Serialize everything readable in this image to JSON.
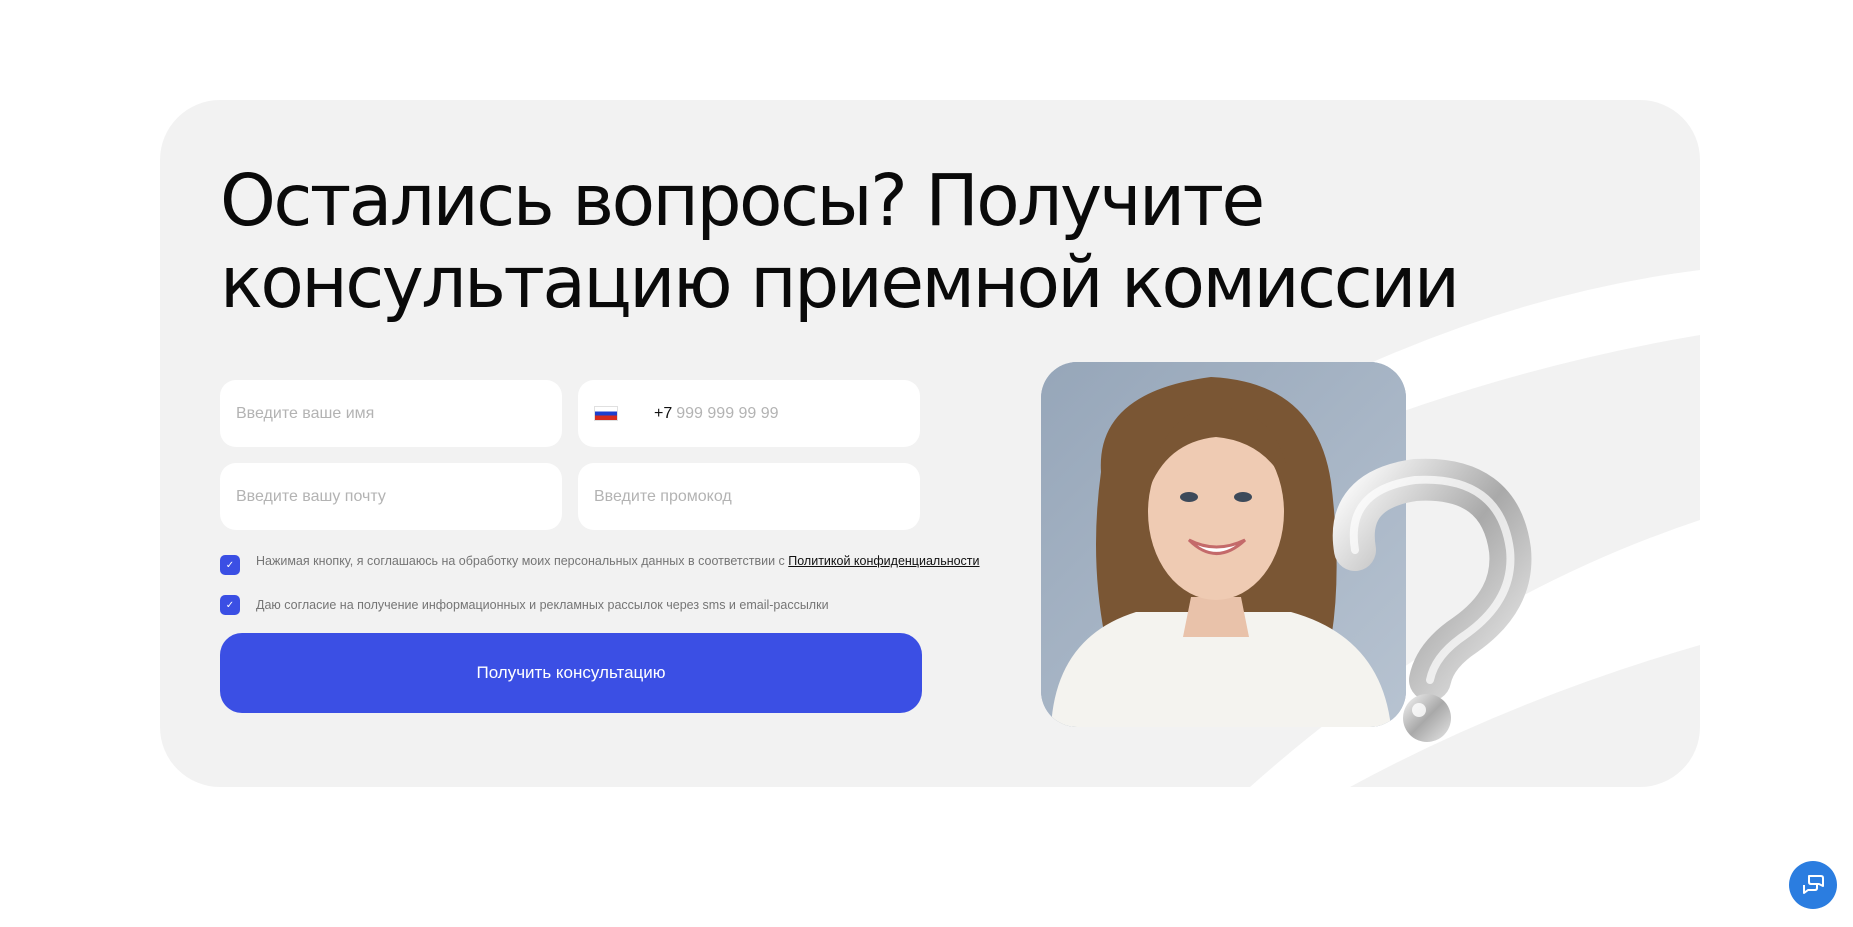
{
  "section": {
    "title": "Остались вопросы? Получите консультацию приемной комиссии"
  },
  "form": {
    "name_placeholder": "Введите ваше имя",
    "phone_prefix": "+7",
    "phone_placeholder": "999 999 99 99",
    "email_placeholder": "Введите вашу почту",
    "promo_placeholder": "Введите промокод",
    "consent_personal_text": "Нажимая кнопку, я соглашаюсь на обработку моих персональных данных в соответствии с",
    "consent_personal_link": "Политикой конфиденциальности",
    "consent_mailing_text": "Даю согласие на получение информационных и рекламных рассылок через sms и email-рассылки",
    "submit_label": "Получить консультацию"
  },
  "icons": {
    "flag": "russia-flag-icon",
    "check": "checkmark-icon",
    "chat": "chat-icon"
  },
  "colors": {
    "accent": "#3b4fe4",
    "card_background": "#f2f2f2",
    "chat_button": "#2b7de0"
  }
}
